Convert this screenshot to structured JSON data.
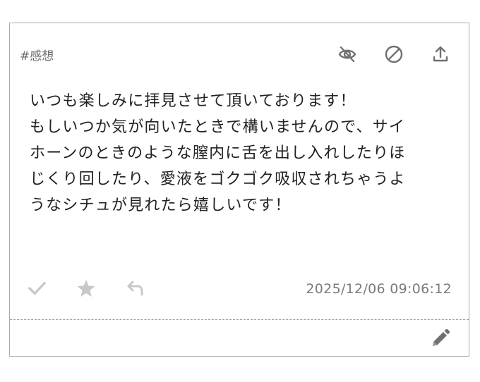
{
  "post": {
    "tag": "#感想",
    "message_lines": [
      "いつも楽しみに拝見させて頂いております！",
      "もしいつか気が向いたときで構いませんので、サイ",
      "ホーンのときのような膣内に舌を出し入れしたりほ",
      "じくり回したり、愛液をゴクゴク吸収されちゃうよ",
      "うなシチュが見れたら嬉しいです！"
    ],
    "timestamp": "2025/12/06 09:06:12"
  },
  "icons": {
    "top": [
      "eye-slash-icon",
      "ban-icon",
      "upload-icon"
    ],
    "bottom": [
      "check-icon",
      "star-icon",
      "reply-icon"
    ],
    "edit": "pencil-icon"
  },
  "colors": {
    "icon_dark": "#707070",
    "icon_light": "#c8c8c8",
    "border": "#a9a9b3",
    "text": "#222222",
    "muted_text": "#7b7b7b"
  }
}
